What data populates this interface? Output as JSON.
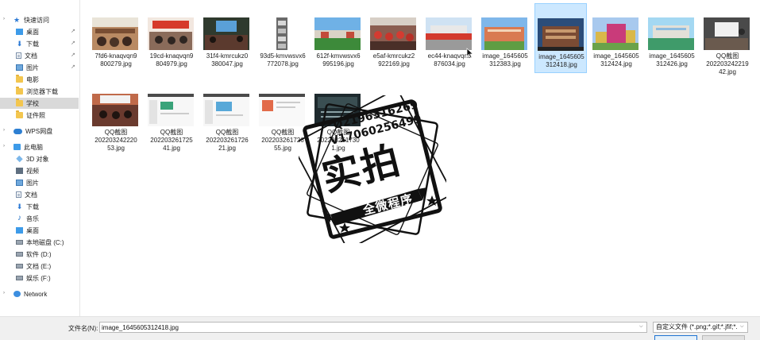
{
  "nav": {
    "items": [
      {
        "label": "快速访问",
        "icon": "star-icon"
      },
      {
        "label": "桌面",
        "icon": "desktop-folder-icon",
        "pinned": true
      },
      {
        "label": "下载",
        "icon": "download-icon",
        "pinned": true
      },
      {
        "label": "文档",
        "icon": "document-icon",
        "pinned": true
      },
      {
        "label": "图片",
        "icon": "picture-icon",
        "pinned": true
      },
      {
        "label": "电影",
        "icon": "folder-icon"
      },
      {
        "label": "浏览器下载",
        "icon": "folder-icon"
      },
      {
        "label": "学校",
        "icon": "folder-icon",
        "selected": true
      },
      {
        "label": "证件照",
        "icon": "folder-icon"
      },
      {
        "label": "WPS网盘",
        "icon": "cloud-icon"
      },
      {
        "label": "此电脑",
        "icon": "computer-icon"
      },
      {
        "label": "3D 对象",
        "icon": "3d-objects-icon"
      },
      {
        "label": "视频",
        "icon": "video-icon"
      },
      {
        "label": "图片",
        "icon": "picture-icon"
      },
      {
        "label": "文档",
        "icon": "document-icon"
      },
      {
        "label": "下载",
        "icon": "download-icon"
      },
      {
        "label": "音乐",
        "icon": "music-icon"
      },
      {
        "label": "桌面",
        "icon": "desktop-folder-icon"
      },
      {
        "label": "本地磁盘 (C:)",
        "icon": "drive-icon"
      },
      {
        "label": "软件 (D:)",
        "icon": "drive-icon"
      },
      {
        "label": "文档 (E:)",
        "icon": "drive-icon"
      },
      {
        "label": "娱乐 (F:)",
        "icon": "drive-icon"
      },
      {
        "label": "Network",
        "icon": "network-icon"
      }
    ]
  },
  "files": [
    {
      "name": "7fd6-knaqvqn9800279.jpg"
    },
    {
      "name": "19cd-knaqvqn9804979.jpg"
    },
    {
      "name": "31f4-kmrcukz0380047.jpg"
    },
    {
      "name": "93d5-kmvwsvx6772078.jpg"
    },
    {
      "name": "612f-kmvwsvx6995196.jpg"
    },
    {
      "name": "e5af-kmrcukz2922169.jpg"
    },
    {
      "name": "ec44-knaqvqn9876034.jpg"
    },
    {
      "name": "image_1645605312383.jpg"
    },
    {
      "name": "image_1645605312418.jpg",
      "selected": true
    },
    {
      "name": "image_1645605312424.jpg"
    },
    {
      "name": "image_1645605312426.jpg"
    },
    {
      "name": "QQ截图20220324221942.jpg"
    },
    {
      "name": "QQ截图20220324222053.jpg"
    },
    {
      "name": "QQ截图20220326172541.jpg"
    },
    {
      "name": "QQ截图20220326172621.jpg"
    },
    {
      "name": "QQ截图20220326172655.jpg"
    },
    {
      "name": "QQ截图2022032617301.jpg"
    }
  ],
  "footer": {
    "filename_label": "文件名(N):",
    "filename_value": "image_1645605312418.jpg",
    "filetype_value": "自定义文件 (*.png;*.gif;*.jfif;*."
  },
  "watermark": {
    "qq": "Q2196316269",
    "vx": "V17060256499",
    "main": "实拍",
    "banner": "全微程序"
  }
}
